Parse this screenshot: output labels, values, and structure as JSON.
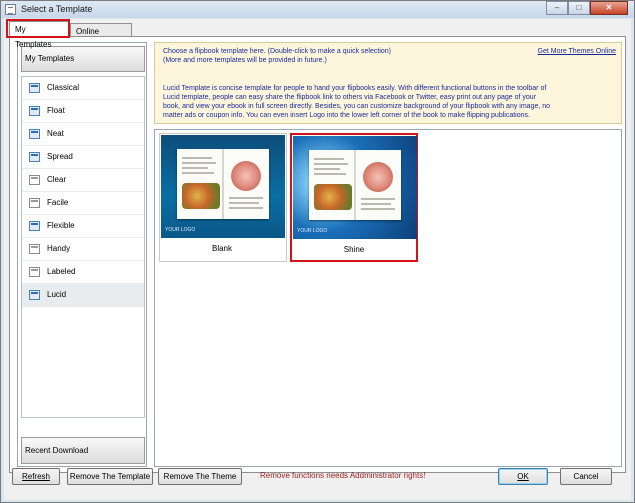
{
  "window": {
    "title": "Select a Template"
  },
  "tabs": [
    {
      "label": "My Templates"
    },
    {
      "label": "Online Templates"
    }
  ],
  "sidebar": {
    "header": "My Templates",
    "items": [
      {
        "label": "Classical",
        "icon": "classical-icon"
      },
      {
        "label": "Float",
        "icon": "float-icon"
      },
      {
        "label": "Neat",
        "icon": "neat-icon"
      },
      {
        "label": "Spread",
        "icon": "spread-icon"
      },
      {
        "label": "Clear",
        "icon": "clear-icon"
      },
      {
        "label": "Facile",
        "icon": "facile-icon"
      },
      {
        "label": "Flexible",
        "icon": "flexible-icon"
      },
      {
        "label": "Handy",
        "icon": "handy-icon"
      },
      {
        "label": "Labeled",
        "icon": "labeled-icon"
      },
      {
        "label": "Lucid",
        "icon": "lucid-icon",
        "selected": true
      }
    ],
    "footer": "Recent Download"
  },
  "info": {
    "line1": "Choose a flipbook template here. (Double-click to make a quick selection)",
    "line2": "(More and more templates will be provided in future.)",
    "desc1": "Lucid Template is concise template for people to hand your flipbooks easily. With different functional buttons in the toolbar of",
    "desc2": "Lucid template, people can easy share the flipbook link to others via Facebook or Twitter, easy print out any page of your",
    "desc3": "book,  and view your ebook in full screen directly. Besides, you can customize background of your flipbook with any image, no",
    "desc4": "matter ads or coupon info. You can even insert Logo into the lower left corner of the book to make flipping publications.",
    "link": "Get More Themes Online"
  },
  "templates": [
    {
      "name": "Blank",
      "brand": "YOUR LOGO",
      "selected": false
    },
    {
      "name": "Shine",
      "brand": "YOUR LOGO",
      "selected": true
    }
  ],
  "buttons": {
    "refresh": "Refresh",
    "remove_template": "Remove The Template",
    "remove_theme": "Remove The Theme",
    "ok": "OK",
    "cancel": "Cancel"
  },
  "status": {
    "warning": "Remove functions needs Addministrator rights!"
  },
  "colors": {
    "highlight": "#d0141a",
    "info_text": "#1a2a9a",
    "warning_text": "#9b1d1d"
  }
}
